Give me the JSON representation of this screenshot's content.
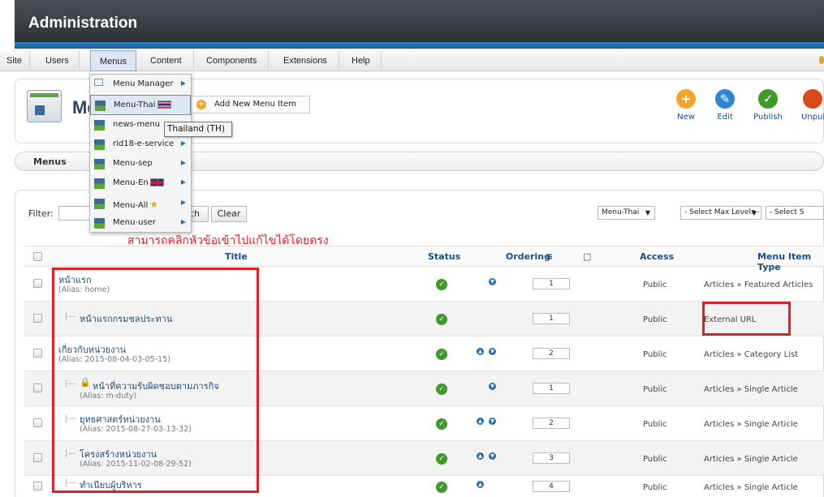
{
  "header": {
    "title": "Administration"
  },
  "menubar": {
    "items": [
      "Site",
      "Users",
      "Menus",
      "Content",
      "Components",
      "Extensions",
      "Help"
    ]
  },
  "page": {
    "title": "Me"
  },
  "toolbar": {
    "new": "New",
    "edit": "Edit",
    "publish": "Publish",
    "unpublish": "Unpub"
  },
  "submenu": {
    "label": "Menus"
  },
  "filter": {
    "label": "Filter:",
    "search_button": "ch",
    "clear_button": "Clear",
    "menu_select": "Menu-Thai",
    "levels_select": "- Select Max Levels -",
    "other_select": "- Select S"
  },
  "annotation": {
    "text": "สามารถคลิกหัวข้อเข้าไปแก้ไขได้โดยตรง"
  },
  "table": {
    "headers": {
      "title": "Title",
      "status": "Status",
      "ordering": "Ordering",
      "access": "Access",
      "type": "Menu Item Type"
    },
    "rows": [
      {
        "title": "หน้าแรก",
        "alias": "(Alias: home)",
        "order": "1",
        "access": "Public",
        "type": "Articles » Featured Articles"
      },
      {
        "title": "หน้าแรกกรมชลประทาน",
        "alias": "",
        "order": "1",
        "access": "Public",
        "type": "External URL"
      },
      {
        "title": "เกี่ยวกับหน่วยงาน",
        "alias": "(Alias: 2015-08-04-03-05-15)",
        "order": "2",
        "access": "Public",
        "type": "Articles » Category List"
      },
      {
        "title": "หน้าที่ความรับผิดชอบตามภารกิจ",
        "alias": "(Alias: m-duty)",
        "order": "1",
        "access": "Public",
        "type": "Articles » Single Article"
      },
      {
        "title": "ยุทธศาสตร์หน่วยงาน",
        "alias": "(Alias: 2015-08-27-03-13-32)",
        "order": "2",
        "access": "Public",
        "type": "Articles » Single Article"
      },
      {
        "title": "โครงสร้างหน่วยงาน",
        "alias": "(Alias: 2015-11-02-08-29-52)",
        "order": "3",
        "access": "Public",
        "type": "Articles » Single Article"
      },
      {
        "title": "ทำเนียบผู้บริหาร",
        "alias": "",
        "order": "4",
        "access": "Public",
        "type": "Articles » Single Article"
      }
    ]
  },
  "dropdown": {
    "items": [
      "Menu Manager",
      "Menu-Thai",
      "news-menu",
      "rid18-e-service",
      "Menu-sep",
      "Menu-En",
      "Menu-All",
      "Menu-user"
    ],
    "add_new": "Add New Menu Item",
    "tooltip": "Thailand (TH)"
  }
}
